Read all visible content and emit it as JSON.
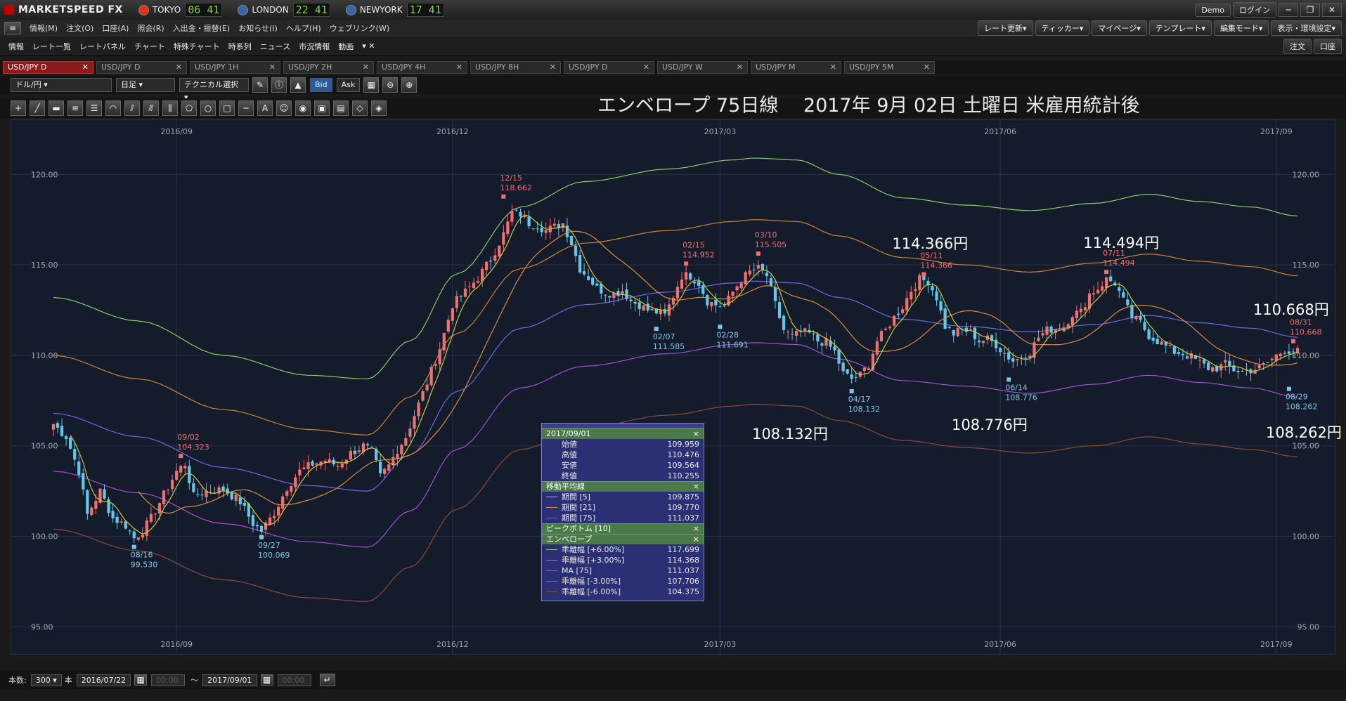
{
  "app": {
    "name": "MARKETSPEED FX",
    "demo": "Demo",
    "login": "ログイン"
  },
  "clocks": [
    {
      "city": "TOKYO",
      "time": "06 41",
      "flag": "#d31"
    },
    {
      "city": "LONDON",
      "time": "22 41",
      "flag": "#36a"
    },
    {
      "city": "NEWYORK",
      "time": "17 41",
      "flag": "#36a"
    }
  ],
  "menu": [
    "情報(M)",
    "注文(O)",
    "口座(A)",
    "照会(R)",
    "入出金・振替(E)",
    "お知らせ(I)",
    "ヘルプ(H)",
    "ウェブリンク(W)"
  ],
  "menu_right": [
    "レート更新▾",
    "ティッカー▾",
    "マイページ▾",
    "テンプレート▾",
    "編集モード▾",
    "表示・環境設定▾"
  ],
  "nav": [
    "情報",
    "レート一覧",
    "レートパネル",
    "チャート",
    "特殊チャート",
    "時系列",
    "ニュース",
    "市況情報",
    "動画"
  ],
  "nav_right": [
    "注文",
    "口座"
  ],
  "tabs": [
    "USD/JPY D",
    "USD/JPY D",
    "USD/JPY 1H",
    "USD/JPY 2H",
    "USD/JPY 4H",
    "USD/JPY 8H",
    "USD/JPY D",
    "USD/JPY W",
    "USD/JPY M",
    "USD/JPY 5M"
  ],
  "controls": {
    "pair": "ドル/円",
    "period": "日足",
    "technical": "テクニカル選択",
    "bid": "Bid",
    "ask": "Ask"
  },
  "bottom": {
    "count_label": "本数:",
    "count": "300",
    "unit": "本",
    "from": "2016/07/22",
    "to": "2017/09/01",
    "tilde": "〜"
  },
  "chart_title": "エンベロープ 75日線　 2017年 9月 02日  土曜日   米雇用統計後",
  "annotations": [
    {
      "text": "114.366円",
      "xi": 206,
      "y": 116.2
    },
    {
      "text": "114.494円",
      "xi": 251,
      "y": 116.25
    },
    {
      "text": "110.668円",
      "xi": 291,
      "y": 112.55
    },
    {
      "text": "108.132円",
      "xi": 173,
      "y": 105.7
    },
    {
      "text": "108.776円",
      "xi": 220,
      "y": 106.2
    },
    {
      "text": "108.262円",
      "xi": 294,
      "y": 105.75
    }
  ],
  "infobox": {
    "date": "2017/09/01",
    "ohlc": [
      [
        "始値",
        "109.959"
      ],
      [
        "高値",
        "110.476"
      ],
      [
        "安値",
        "109.564"
      ],
      [
        "終値",
        "110.255"
      ]
    ],
    "ma_title": "移動平均線",
    "ma": [
      [
        "期間 [5]",
        "109.875",
        "#c8c83a"
      ],
      [
        "期間 [21]",
        "109.770",
        "#e08a3a"
      ],
      [
        "期間 [75]",
        "111.037",
        "#6a6ae0"
      ]
    ],
    "peak_title": "ピークボトム [10]",
    "env_title": "エンベロープ",
    "env": [
      [
        "乖離幅 [+6.00%]",
        "117.699",
        "#8acb6a"
      ],
      [
        "乖離幅 [+3.00%]",
        "114.368",
        "#d08030"
      ],
      [
        "MA [75]",
        "111.037",
        "#6a6ae0"
      ],
      [
        "乖離幅 [-3.00%]",
        "107.706",
        "#a050d0"
      ],
      [
        "乖離幅 [-6.00%]",
        "104.375",
        "#8a4a30"
      ]
    ]
  },
  "colors": {
    "bg": "#141c2c",
    "up": "#f07070",
    "down": "#60c8e8",
    "ma5": "#c8c83a",
    "ma21": "#e08a3a",
    "ma75": "#6a6ae0",
    "envp6": "#8acb6a",
    "envp3": "#d08030",
    "envm3": "#a050d0",
    "envm6": "#8a4a30",
    "grid": "#2a3448",
    "peak": "#f07070",
    "bottom": "#7ac8e8"
  },
  "chart_data": {
    "type": "candlestick",
    "symbol": "USD/JPY",
    "timeframe": "日足",
    "ylim": [
      93.5,
      123.0
    ],
    "yticks": [
      95.0,
      100.0,
      105.0,
      110.0,
      115.0,
      120.0
    ],
    "xticks": [
      {
        "label": "2016/09",
        "index": 29
      },
      {
        "label": "2016/12",
        "index": 94
      },
      {
        "label": "2017/03",
        "index": 157
      },
      {
        "label": "2017/06",
        "index": 223
      },
      {
        "label": "2017/09",
        "index": 288
      }
    ],
    "close_keypoints": [
      [
        0,
        106.2
      ],
      [
        3,
        105.5
      ],
      [
        6,
        103.6
      ],
      [
        8,
        101.2
      ],
      [
        11,
        102.5
      ],
      [
        14,
        101.0
      ],
      [
        17,
        100.6
      ],
      [
        19,
        99.9
      ],
      [
        21,
        100.3
      ],
      [
        23,
        101.0
      ],
      [
        26,
        102.3
      ],
      [
        29,
        103.6
      ],
      [
        31,
        104.0
      ],
      [
        33,
        102.2
      ],
      [
        36,
        102.5
      ],
      [
        40,
        102.6
      ],
      [
        44,
        101.9
      ],
      [
        47,
        100.7
      ],
      [
        49,
        100.3
      ],
      [
        52,
        101.3
      ],
      [
        55,
        102.7
      ],
      [
        58,
        103.6
      ],
      [
        61,
        104.0
      ],
      [
        64,
        104.2
      ],
      [
        67,
        103.9
      ],
      [
        70,
        104.6
      ],
      [
        73,
        105.0
      ],
      [
        75,
        104.7
      ],
      [
        77,
        103.3
      ],
      [
        79,
        103.9
      ],
      [
        81,
        104.8
      ],
      [
        83,
        105.5
      ],
      [
        85,
        106.7
      ],
      [
        88,
        108.5
      ],
      [
        91,
        110.4
      ],
      [
        94,
        112.8
      ],
      [
        97,
        113.5
      ],
      [
        100,
        114.3
      ],
      [
        103,
        115.3
      ],
      [
        106,
        116.7
      ],
      [
        108,
        117.9
      ],
      [
        110,
        117.8
      ],
      [
        112,
        117.3
      ],
      [
        114,
        117.2
      ],
      [
        116,
        116.9
      ],
      [
        118,
        117.1
      ],
      [
        120,
        117.3
      ],
      [
        122,
        116.2
      ],
      [
        124,
        114.8
      ],
      [
        126,
        114.3
      ],
      [
        128,
        113.7
      ],
      [
        130,
        113.5
      ],
      [
        132,
        113.4
      ],
      [
        134,
        113.6
      ],
      [
        136,
        113.0
      ],
      [
        138,
        112.8
      ],
      [
        140,
        112.5
      ],
      [
        142,
        112.4
      ],
      [
        144,
        112.2
      ],
      [
        146,
        113.3
      ],
      [
        148,
        114.4
      ],
      [
        150,
        114.4
      ],
      [
        152,
        114.0
      ],
      [
        154,
        113.0
      ],
      [
        156,
        112.8
      ],
      [
        158,
        112.7
      ],
      [
        160,
        113.5
      ],
      [
        162,
        114.2
      ],
      [
        164,
        114.6
      ],
      [
        166,
        114.8
      ],
      [
        168,
        114.4
      ],
      [
        170,
        112.8
      ],
      [
        172,
        111.4
      ],
      [
        174,
        111.0
      ],
      [
        176,
        111.3
      ],
      [
        178,
        111.2
      ],
      [
        180,
        110.8
      ],
      [
        182,
        110.7
      ],
      [
        184,
        110.2
      ],
      [
        186,
        109.0
      ],
      [
        188,
        108.7
      ],
      [
        190,
        108.9
      ],
      [
        192,
        109.5
      ],
      [
        194,
        110.8
      ],
      [
        196,
        111.4
      ],
      [
        198,
        112.1
      ],
      [
        200,
        112.7
      ],
      [
        202,
        113.6
      ],
      [
        204,
        114.2
      ],
      [
        206,
        114.1
      ],
      [
        208,
        113.2
      ],
      [
        210,
        111.6
      ],
      [
        212,
        111.2
      ],
      [
        214,
        111.4
      ],
      [
        216,
        111.3
      ],
      [
        218,
        110.8
      ],
      [
        220,
        110.9
      ],
      [
        222,
        110.6
      ],
      [
        224,
        110.1
      ],
      [
        226,
        109.7
      ],
      [
        228,
        109.9
      ],
      [
        230,
        110.2
      ],
      [
        232,
        111.0
      ],
      [
        234,
        111.4
      ],
      [
        236,
        111.5
      ],
      [
        238,
        111.6
      ],
      [
        240,
        112.3
      ],
      [
        242,
        112.4
      ],
      [
        244,
        113.4
      ],
      [
        246,
        113.7
      ],
      [
        248,
        114.2
      ],
      [
        250,
        114.0
      ],
      [
        252,
        113.0
      ],
      [
        254,
        112.1
      ],
      [
        256,
        111.8
      ],
      [
        258,
        111.1
      ],
      [
        260,
        110.8
      ],
      [
        262,
        110.5
      ],
      [
        264,
        110.2
      ],
      [
        266,
        110.1
      ],
      [
        268,
        109.9
      ],
      [
        270,
        109.6
      ],
      [
        272,
        109.3
      ],
      [
        274,
        109.3
      ],
      [
        276,
        109.5
      ],
      [
        278,
        109.2
      ],
      [
        280,
        109.1
      ],
      [
        282,
        109.2
      ],
      [
        284,
        109.3
      ],
      [
        286,
        109.6
      ],
      [
        288,
        110.0
      ],
      [
        290,
        110.3
      ],
      [
        293,
        110.2
      ]
    ],
    "ma75": [
      [
        0,
        106.8
      ],
      [
        20,
        105.5
      ],
      [
        40,
        103.8
      ],
      [
        60,
        102.8
      ],
      [
        74,
        102.5
      ],
      [
        84,
        104.5
      ],
      [
        95,
        108.0
      ],
      [
        110,
        111.5
      ],
      [
        125,
        112.8
      ],
      [
        145,
        113.5
      ],
      [
        160,
        114.0
      ],
      [
        165,
        114.1
      ],
      [
        175,
        114.0
      ],
      [
        185,
        113.2
      ],
      [
        200,
        112.0
      ],
      [
        215,
        111.6
      ],
      [
        230,
        111.3
      ],
      [
        245,
        111.7
      ],
      [
        258,
        112.2
      ],
      [
        270,
        111.8
      ],
      [
        282,
        111.5
      ],
      [
        293,
        111.0
      ]
    ],
    "envelope_plus6": [
      [
        0,
        113.2
      ],
      [
        20,
        111.9
      ],
      [
        40,
        110.0
      ],
      [
        60,
        108.9
      ],
      [
        74,
        108.7
      ],
      [
        84,
        110.8
      ],
      [
        95,
        114.5
      ],
      [
        110,
        118.2
      ],
      [
        125,
        119.6
      ],
      [
        145,
        120.3
      ],
      [
        160,
        120.8
      ],
      [
        165,
        120.9
      ],
      [
        175,
        120.8
      ],
      [
        185,
        120.0
      ],
      [
        200,
        118.7
      ],
      [
        215,
        118.3
      ],
      [
        230,
        118.0
      ],
      [
        245,
        118.4
      ],
      [
        258,
        118.9
      ],
      [
        270,
        118.5
      ],
      [
        282,
        118.2
      ],
      [
        293,
        117.7
      ]
    ],
    "envelope_plus3": [
      [
        0,
        110.0
      ],
      [
        20,
        108.7
      ],
      [
        40,
        107.0
      ],
      [
        60,
        105.9
      ],
      [
        74,
        105.6
      ],
      [
        84,
        107.7
      ],
      [
        95,
        111.2
      ],
      [
        110,
        114.8
      ],
      [
        125,
        116.2
      ],
      [
        145,
        116.9
      ],
      [
        160,
        117.4
      ],
      [
        165,
        117.5
      ],
      [
        175,
        117.4
      ],
      [
        185,
        116.6
      ],
      [
        200,
        115.4
      ],
      [
        215,
        115.0
      ],
      [
        230,
        114.6
      ],
      [
        245,
        115.1
      ],
      [
        258,
        115.6
      ],
      [
        270,
        115.2
      ],
      [
        282,
        114.9
      ],
      [
        293,
        114.4
      ]
    ],
    "envelope_minus3": [
      [
        0,
        103.6
      ],
      [
        20,
        102.4
      ],
      [
        40,
        100.7
      ],
      [
        60,
        99.7
      ],
      [
        74,
        99.4
      ],
      [
        84,
        101.4
      ],
      [
        95,
        104.8
      ],
      [
        110,
        108.2
      ],
      [
        125,
        109.4
      ],
      [
        145,
        110.1
      ],
      [
        160,
        110.6
      ],
      [
        165,
        110.7
      ],
      [
        175,
        110.6
      ],
      [
        185,
        109.8
      ],
      [
        200,
        108.6
      ],
      [
        215,
        108.3
      ],
      [
        230,
        107.9
      ],
      [
        245,
        108.4
      ],
      [
        258,
        108.9
      ],
      [
        270,
        108.5
      ],
      [
        282,
        108.2
      ],
      [
        293,
        107.7
      ]
    ],
    "envelope_minus6": [
      [
        0,
        100.4
      ],
      [
        20,
        99.2
      ],
      [
        40,
        97.6
      ],
      [
        60,
        96.6
      ],
      [
        74,
        96.4
      ],
      [
        84,
        98.3
      ],
      [
        95,
        101.5
      ],
      [
        110,
        104.8
      ],
      [
        125,
        106.0
      ],
      [
        145,
        106.7
      ],
      [
        160,
        107.2
      ],
      [
        165,
        107.3
      ],
      [
        175,
        107.2
      ],
      [
        185,
        106.4
      ],
      [
        200,
        105.3
      ],
      [
        215,
        104.9
      ],
      [
        230,
        104.6
      ],
      [
        245,
        105.0
      ],
      [
        258,
        105.5
      ],
      [
        270,
        105.1
      ],
      [
        282,
        104.8
      ],
      [
        293,
        104.4
      ]
    ],
    "peaks": [
      {
        "date": "09/02",
        "value": "104.323",
        "xi": 30,
        "y": 104.323
      },
      {
        "date": "12/15",
        "value": "118.662",
        "xi": 106,
        "y": 118.662
      },
      {
        "date": "02/15",
        "value": "114.952",
        "xi": 149,
        "y": 114.952
      },
      {
        "date": "03/10",
        "value": "115.505",
        "xi": 166,
        "y": 115.505
      },
      {
        "date": "05/11",
        "value": "114.366",
        "xi": 205,
        "y": 114.366
      },
      {
        "date": "07/11",
        "value": "114.494",
        "xi": 248,
        "y": 114.494
      },
      {
        "date": "08/31",
        "value": "110.668",
        "xi": 292,
        "y": 110.668
      }
    ],
    "bottoms": [
      {
        "date": "08/16",
        "value": "99.530",
        "xi": 19,
        "y": 99.53
      },
      {
        "date": "09/27",
        "value": "100.069",
        "xi": 49,
        "y": 100.069
      },
      {
        "date": "02/07",
        "value": "111.585",
        "xi": 142,
        "y": 111.585
      },
      {
        "date": "02/28",
        "value": "111.691",
        "xi": 157,
        "y": 111.691
      },
      {
        "date": "04/17",
        "value": "108.132",
        "xi": 188,
        "y": 108.132
      },
      {
        "date": "06/14",
        "value": "108.776",
        "xi": 225,
        "y": 108.776
      },
      {
        "date": "08/29",
        "value": "108.262",
        "xi": 291,
        "y": 108.262
      }
    ]
  }
}
